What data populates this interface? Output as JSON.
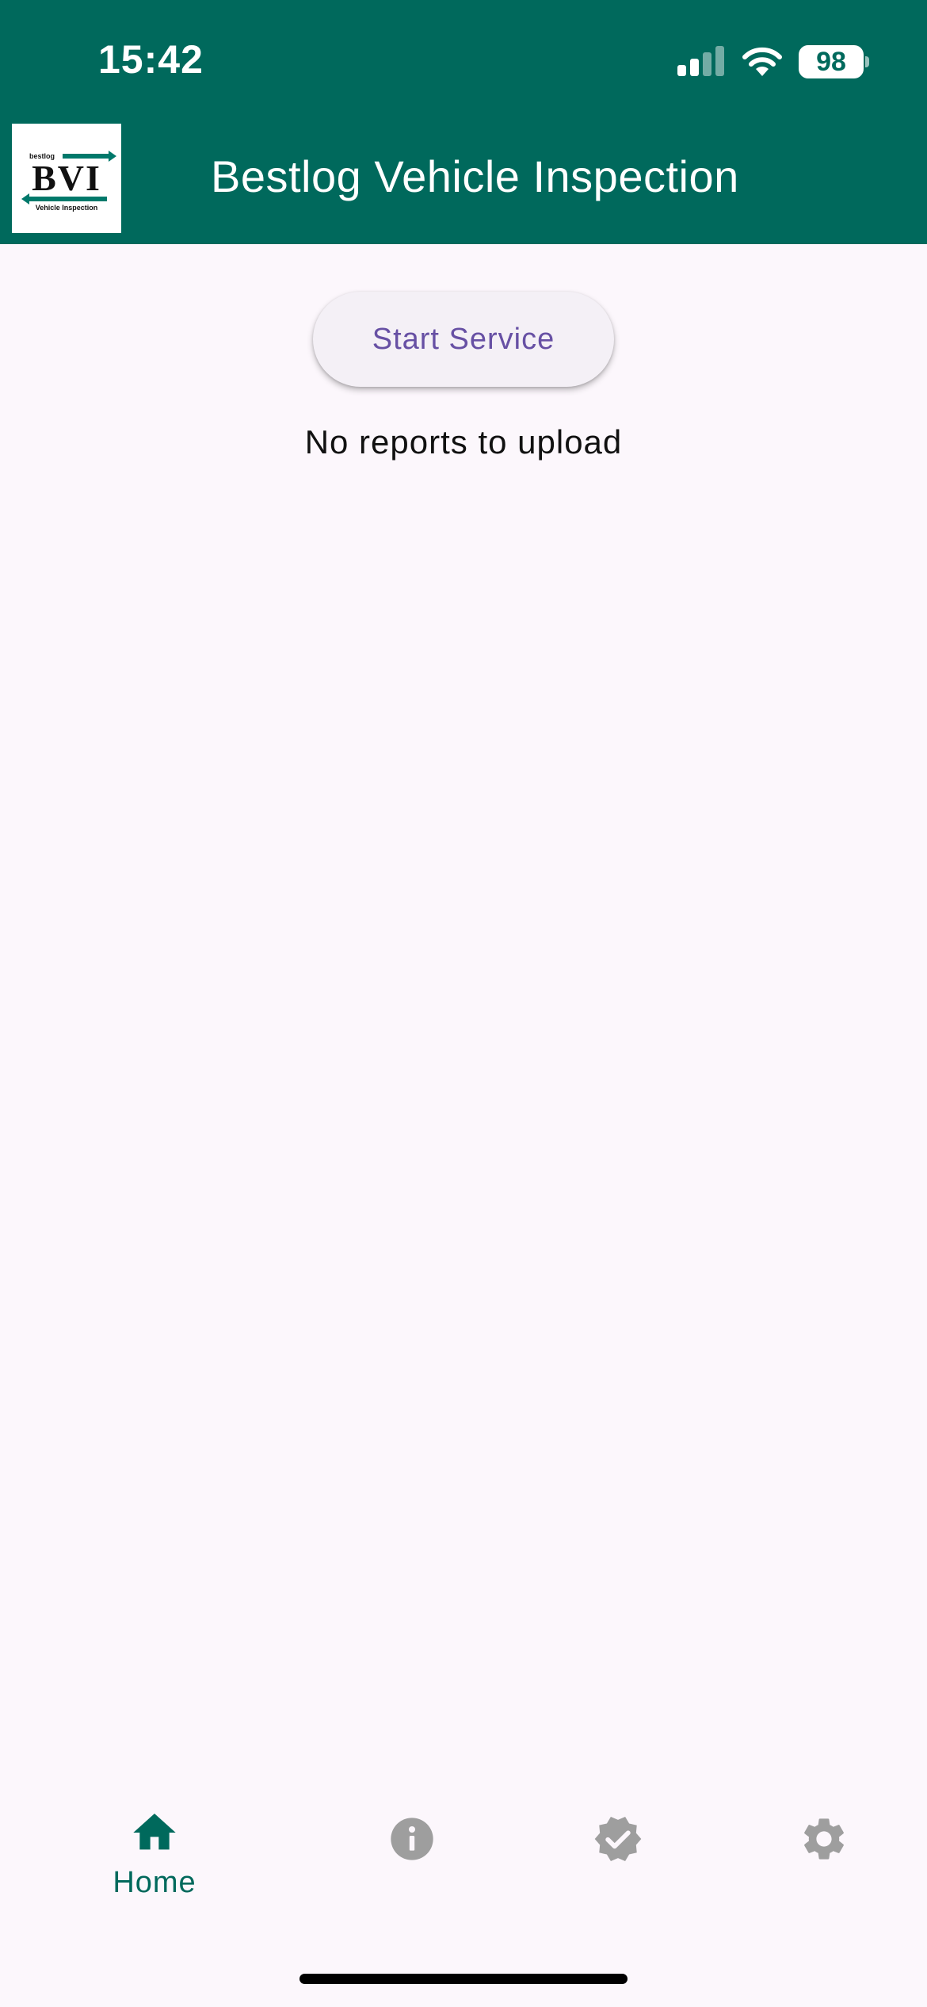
{
  "status_bar": {
    "time": "15:42",
    "battery": "98",
    "signal_icon": "cellular-signal-icon",
    "wifi_icon": "wifi-icon"
  },
  "app_bar": {
    "title": "Bestlog Vehicle Inspection",
    "logo": {
      "small_text": "bestlog",
      "main_text": "BVI",
      "sub_text": "Vehicle Inspection"
    },
    "background_color": "#00695C"
  },
  "main": {
    "start_button_label": "Start Service",
    "status_message": "No reports to upload",
    "background_color": "#FCF7FC",
    "button_text_color": "#6750A4"
  },
  "bottom_nav": {
    "items": [
      {
        "label": "Home",
        "icon": "home-icon",
        "active": true
      },
      {
        "label": "",
        "icon": "info-icon",
        "active": false
      },
      {
        "label": "",
        "icon": "verified-badge-icon",
        "active": false
      },
      {
        "label": "",
        "icon": "gear-icon",
        "active": false
      }
    ],
    "active_color": "#00695C",
    "inactive_color": "#9E9E9E"
  }
}
